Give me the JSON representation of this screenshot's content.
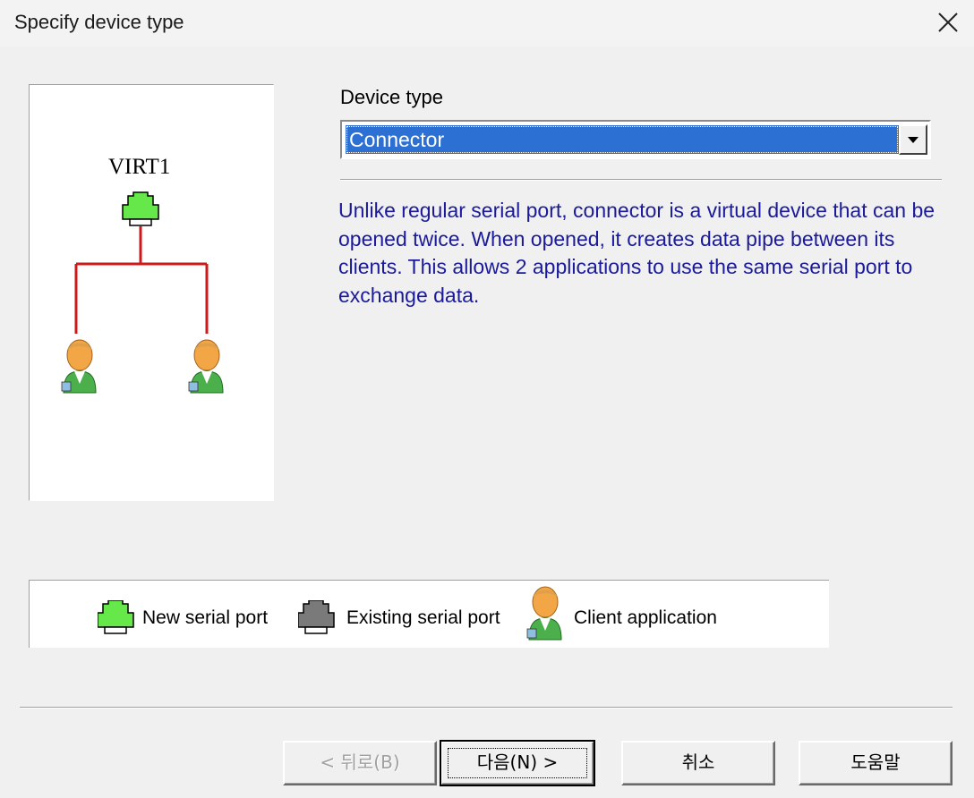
{
  "window": {
    "title": "Specify device type"
  },
  "diagram": {
    "device_name": "VIRT1"
  },
  "device_type": {
    "label": "Device type",
    "selected": "Connector"
  },
  "description": "Unlike regular serial port, connector is a virtual device that can be opened twice. When opened, it creates data pipe between its clients. This allows 2 applications to use the same serial port to exchange data.",
  "legend": {
    "new_serial_port": "New serial port",
    "existing_serial_port": "Existing serial port",
    "client_application": "Client application"
  },
  "buttons": {
    "back": "< 뒤로(B)",
    "next": "다음(N) >",
    "cancel": "취소",
    "help": "도움말"
  },
  "colors": {
    "new_port": "#66e84a",
    "existing_port": "#7a7a7a",
    "connector_line": "#cc1a1a",
    "description_text": "#1a1a9a",
    "selection": "#2c70d4"
  }
}
